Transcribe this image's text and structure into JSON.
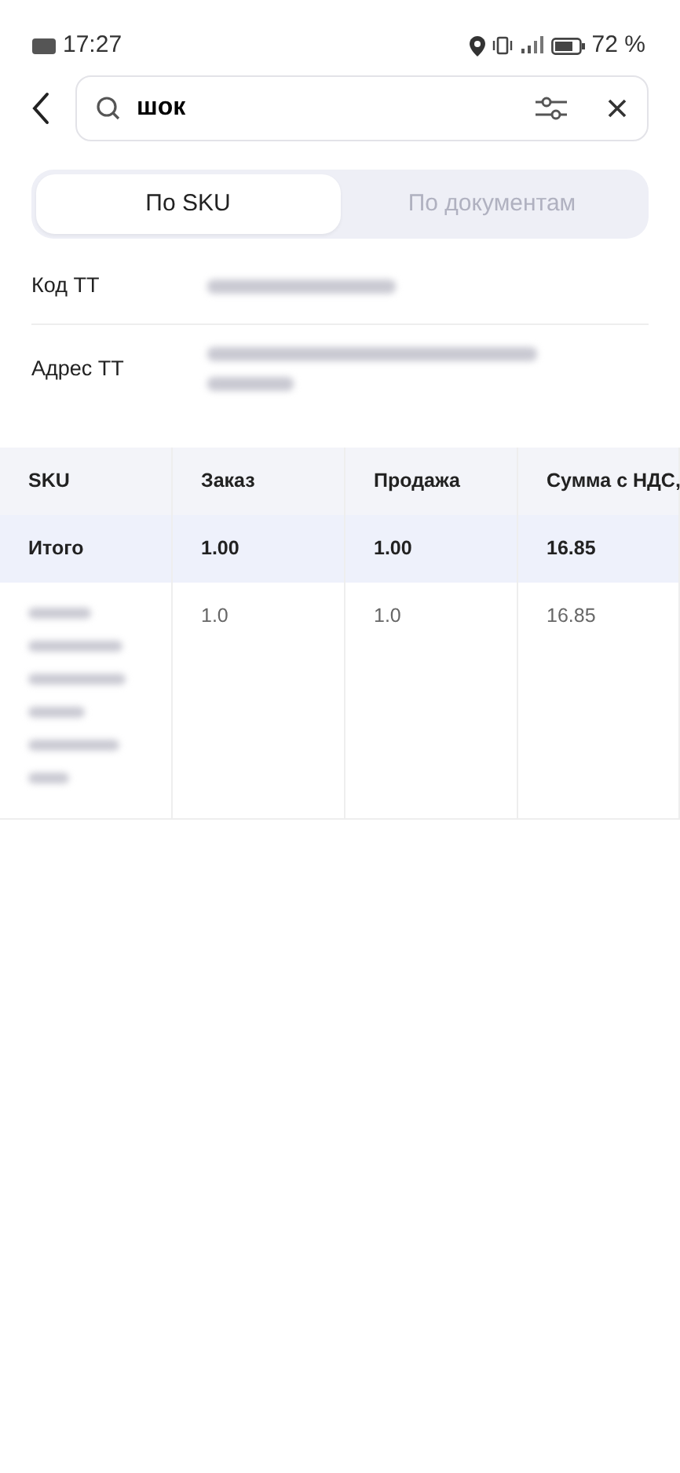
{
  "status_bar": {
    "time": "17:27",
    "battery": "72 %"
  },
  "search": {
    "value": "шок"
  },
  "tabs": [
    {
      "label": "По SKU",
      "selected": true
    },
    {
      "label": "По документам",
      "selected": false
    }
  ],
  "info": [
    {
      "label": "Код ТТ",
      "redacted": true
    },
    {
      "label": "Адрес ТТ",
      "redacted": true
    }
  ],
  "table": {
    "columns": [
      "SKU",
      "Заказ",
      "Продажа",
      "Сумма с НДС,"
    ],
    "rows": [
      {
        "kind": "total",
        "cells": [
          "Итого",
          "1.00",
          "1.00",
          "16.85"
        ]
      },
      {
        "kind": "item",
        "redacted": true,
        "cells": [
          "",
          "1.0",
          "1.0",
          "16.85"
        ]
      }
    ]
  }
}
